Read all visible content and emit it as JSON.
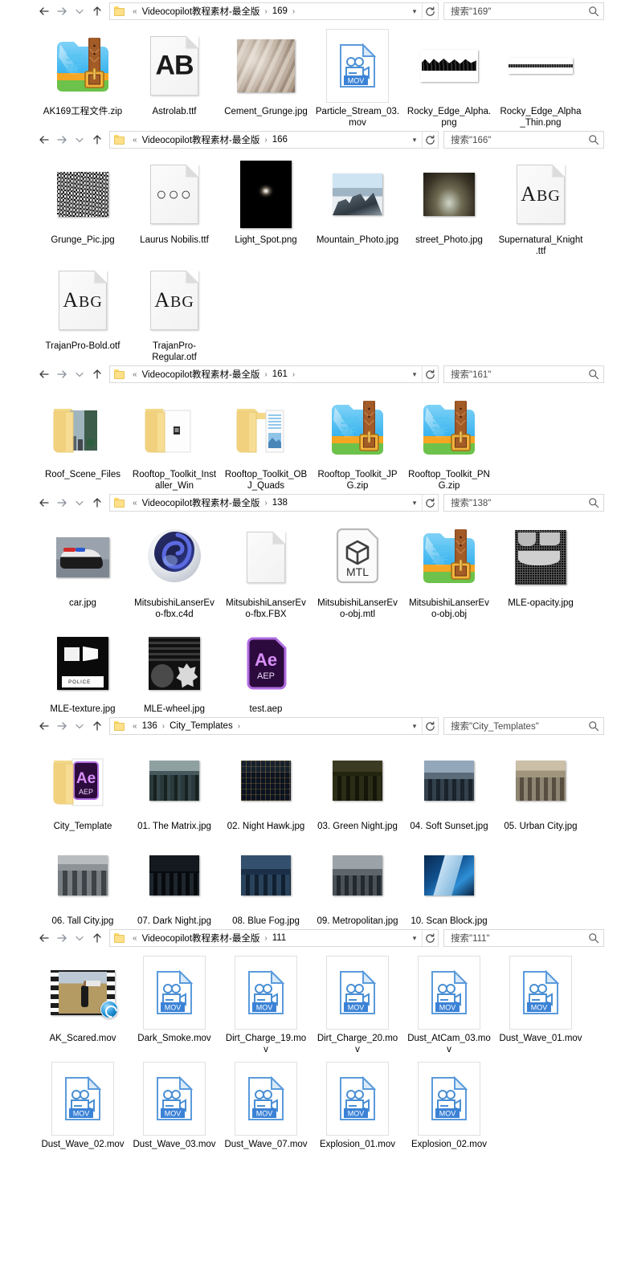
{
  "app": {
    "name": "Windows File Explorer",
    "nav_icons": {
      "back": "back-arrow-icon",
      "forward": "forward-arrow-icon",
      "recent": "recent-locations-chevron-icon",
      "up": "up-arrow-icon",
      "folder": "folder-icon",
      "dropdown": "address-dropdown-icon",
      "refresh": "refresh-icon",
      "search": "search-icon"
    },
    "colors": {
      "accent": "#1f8fd4",
      "folder_yellow": "#ffe08a",
      "mov_blue": "#3b82d6",
      "aep_purple": "#3a0a4e",
      "aep_magenta": "#d88ef7",
      "border": "#d9d9d9",
      "text": "#000000"
    }
  },
  "panes": [
    {
      "id": "pane-169",
      "breadcrumb": {
        "overflow": "«",
        "parts": [
          "Videocopilot教程素材-最全版",
          "169"
        ],
        "trailing_chevron": true
      },
      "search_placeholder": "搜索\"169\"",
      "rows": [
        [
          {
            "name": "AK169工程文件.zip",
            "icon": "zip-360-icon"
          },
          {
            "name": "Astrolab.ttf",
            "icon": "font-file-icon",
            "glyph": "AB"
          },
          {
            "name": "Cement_Grunge.jpg",
            "icon": "photo-thumbnail",
            "thumb": "cement"
          },
          {
            "name": "Particle_Stream_03.mov",
            "icon": "mov-file-icon"
          },
          {
            "name": "Rocky_Edge_Alpha.png",
            "icon": "photo-thumbnail",
            "thumb": "rocky"
          },
          {
            "name": "Rocky_Edge_Alpha_Thin.png",
            "icon": "photo-thumbnail",
            "thumb": "rockythin"
          }
        ]
      ]
    },
    {
      "id": "pane-166",
      "breadcrumb": {
        "overflow": "«",
        "parts": [
          "Videocopilot教程素材-最全版",
          "166"
        ],
        "trailing_chevron": false
      },
      "search_placeholder": "搜索\"166\"",
      "rows": [
        [
          {
            "name": "Grunge_Pic.jpg",
            "icon": "photo-thumbnail",
            "thumb": "grunge"
          },
          {
            "name": "Laurus Nobilis.ttf",
            "icon": "font-file-icon",
            "glyph": "OUO"
          },
          {
            "name": "Light_Spot.png",
            "icon": "photo-thumbnail",
            "thumb": "lightspot"
          },
          {
            "name": "Mountain_Photo.jpg",
            "icon": "photo-thumbnail",
            "thumb": "mountain"
          },
          {
            "name": "street_Photo.jpg",
            "icon": "photo-thumbnail",
            "thumb": "street"
          },
          {
            "name": "Supernatural_Knight.ttf",
            "icon": "font-file-icon",
            "glyph": "ABG"
          }
        ],
        [
          {
            "name": "TrajanPro-Bold.otf",
            "icon": "font-file-icon",
            "glyph": "ABG"
          },
          {
            "name": "TrajanPro-Regular.otf",
            "icon": "font-file-icon",
            "glyph": "ABG"
          }
        ]
      ]
    },
    {
      "id": "pane-161",
      "breadcrumb": {
        "overflow": "«",
        "parts": [
          "Videocopilot教程素材-最全版",
          "161"
        ],
        "trailing_chevron": true
      },
      "search_placeholder": "搜索\"161\"",
      "rows": [
        [
          {
            "name": "Roof_Scene_Files",
            "icon": "folder-icon",
            "thumb": "roof"
          },
          {
            "name": "Rooftop_Toolkit_Installer_Win",
            "icon": "folder-icon",
            "thumb": "installer"
          },
          {
            "name": "Rooftop_Toolkit_OBJ_Quads",
            "icon": "folder-icon",
            "thumb": "objquads"
          },
          {
            "name": "Rooftop_Toolkit_JPG.zip",
            "icon": "zip-360-icon"
          },
          {
            "name": "Rooftop_Toolkit_PNG.zip",
            "icon": "zip-360-icon"
          }
        ]
      ]
    },
    {
      "id": "pane-138",
      "breadcrumb": {
        "overflow": "«",
        "parts": [
          "Videocopilot教程素材-最全版",
          "138"
        ],
        "trailing_chevron": false
      },
      "search_placeholder": "搜索\"138\"",
      "rows": [
        [
          {
            "name": "car.jpg",
            "icon": "photo-thumbnail",
            "thumb": "car"
          },
          {
            "name": "MitsubishiLanserEvo-fbx.c4d",
            "icon": "cinema4d-icon"
          },
          {
            "name": "MitsubishiLanserEvo-fbx.FBX",
            "icon": "blank-document-icon"
          },
          {
            "name": "MitsubishiLanserEvo-obj.mtl",
            "icon": "mtl-file-icon",
            "glyph": "MTL"
          },
          {
            "name": "MitsubishiLanserEvo-obj.obj",
            "icon": "zip-360-icon"
          },
          {
            "name": "MLE-opacity.jpg",
            "icon": "photo-thumbnail",
            "thumb": "opacity"
          }
        ],
        [
          {
            "name": "MLE-texture.jpg",
            "icon": "photo-thumbnail",
            "thumb": "texture"
          },
          {
            "name": "MLE-wheel.jpg",
            "icon": "photo-thumbnail",
            "thumb": "wheel"
          },
          {
            "name": "test.aep",
            "icon": "after-effects-aep-icon"
          }
        ]
      ]
    },
    {
      "id": "pane-city",
      "breadcrumb": {
        "overflow": "«",
        "parts": [
          "136",
          "City_Templates"
        ],
        "trailing_chevron": true
      },
      "search_placeholder": "搜索\"City_Templates\"",
      "rows": [
        [
          {
            "name": "City_Template",
            "icon": "folder-icon",
            "thumb": "aepfolder"
          },
          {
            "name": "01. The Matrix.jpg",
            "icon": "photo-thumbnail",
            "thumb": "city1"
          },
          {
            "name": "02. Night Hawk.jpg",
            "icon": "photo-thumbnail",
            "thumb": "city2"
          },
          {
            "name": "03. Green Night.jpg",
            "icon": "photo-thumbnail",
            "thumb": "city3"
          },
          {
            "name": "04. Soft Sunset.jpg",
            "icon": "photo-thumbnail",
            "thumb": "city4"
          },
          {
            "name": "05. Urban City.jpg",
            "icon": "photo-thumbnail",
            "thumb": "city5"
          }
        ],
        [
          {
            "name": "06. Tall City.jpg",
            "icon": "photo-thumbnail",
            "thumb": "city6"
          },
          {
            "name": "07. Dark Night.jpg",
            "icon": "photo-thumbnail",
            "thumb": "city7"
          },
          {
            "name": "08. Blue Fog.jpg",
            "icon": "photo-thumbnail",
            "thumb": "city8"
          },
          {
            "name": "09. Metropolitan.jpg",
            "icon": "photo-thumbnail",
            "thumb": "city9"
          },
          {
            "name": "10. Scan Block.jpg",
            "icon": "photo-thumbnail",
            "thumb": "city10"
          }
        ]
      ]
    },
    {
      "id": "pane-111",
      "breadcrumb": {
        "overflow": "«",
        "parts": [
          "Videocopilot教程素材-最全版",
          "111"
        ],
        "trailing_chevron": false
      },
      "search_placeholder": "搜索\"111\"",
      "rows": [
        [
          {
            "name": "AK_Scared.mov",
            "icon": "video-filmstrip-thumbnail",
            "badge": "sync-badge-icon"
          },
          {
            "name": "Dark_Smoke.mov",
            "icon": "mov-file-icon"
          },
          {
            "name": "Dirt_Charge_19.mov",
            "icon": "mov-file-icon"
          },
          {
            "name": "Dirt_Charge_20.mov",
            "icon": "mov-file-icon"
          },
          {
            "name": "Dust_AtCam_03.mov",
            "icon": "mov-file-icon"
          },
          {
            "name": "Dust_Wave_01.mov",
            "icon": "mov-file-icon"
          }
        ],
        [
          {
            "name": "Dust_Wave_02.mov",
            "icon": "mov-file-icon"
          },
          {
            "name": "Dust_Wave_03.mov",
            "icon": "mov-file-icon"
          },
          {
            "name": "Dust_Wave_07.mov",
            "icon": "mov-file-icon"
          },
          {
            "name": "Explosion_01.mov",
            "icon": "mov-file-icon"
          },
          {
            "name": "Explosion_02.mov",
            "icon": "mov-file-icon"
          }
        ]
      ]
    }
  ]
}
